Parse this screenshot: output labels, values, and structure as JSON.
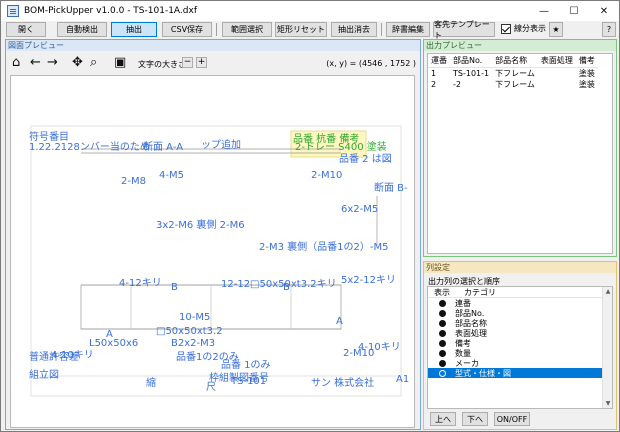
{
  "window": {
    "title": "BOM-PickUpper v1.0.0 - TS-101-1A.dxf",
    "min": "—",
    "max": "☐",
    "close": "✕"
  },
  "toolbar": {
    "open": "開く",
    "auto_detect": "自動検出",
    "extract": "抽出",
    "csv_save": "CSV保存",
    "range_select": "範囲選択",
    "rect_reset": "矩形リセット",
    "extract_clear": "抽出消去",
    "dict_edit": "辞書編集",
    "client_template": "客先テンプレート",
    "show_lines": "線分表示",
    "star": "★",
    "help": "?"
  },
  "drawing_panel": {
    "title": "図面プレビュー",
    "font_size_label": "文字の大きさ",
    "minus": "−",
    "plus": "+",
    "coord": "(x, y) = (4546 , 1752 )",
    "labels": [
      {
        "t": "符号番目",
        "c": "#3a6fd8"
      },
      {
        "t": "1.22.2128ンバー当のため",
        "c": "#3a6fd8"
      },
      {
        "t": "断面 A-A",
        "c": "#3a6fd8"
      },
      {
        "t": "ップ追加",
        "c": "#3a6fd8"
      },
      {
        "t": "品番 杭番 備考",
        "c": "#2fa82f"
      },
      {
        "t": "2-ドレー S400 塗装",
        "c": "#2fa82f"
      },
      {
        "t": "品番 2 は図",
        "c": "#3a6fd8"
      },
      {
        "t": "2-M8",
        "c": "#3a6fd8"
      },
      {
        "t": "4-M5",
        "c": "#3a6fd8"
      },
      {
        "t": "2-M10",
        "c": "#3a6fd8"
      },
      {
        "t": "断面 B-",
        "c": "#3a6fd8"
      },
      {
        "t": "6x2-M5",
        "c": "#3a6fd8"
      },
      {
        "t": "3x2-M6 裏側 2-M6",
        "c": "#3a6fd8"
      },
      {
        "t": "2-M3 裏側（品番1の2）-M5",
        "c": "#3a6fd8"
      },
      {
        "t": "4-12キリ",
        "c": "#3a6fd8"
      },
      {
        "t": "12-12□50x50xt3.2キリ",
        "c": "#3a6fd8"
      },
      {
        "t": "5x2-12キリ",
        "c": "#3a6fd8"
      },
      {
        "t": "B",
        "c": "#3a6fd8"
      },
      {
        "t": "B",
        "c": "#3a6fd8"
      },
      {
        "t": "10-M5",
        "c": "#3a6fd8"
      },
      {
        "t": "□50x50xt3.2",
        "c": "#3a6fd8"
      },
      {
        "t": "A",
        "c": "#3a6fd8"
      },
      {
        "t": "A",
        "c": "#3a6fd8"
      },
      {
        "t": "L50x50x6",
        "c": "#3a6fd8"
      },
      {
        "t": "4-10キリ",
        "c": "#3a6fd8"
      },
      {
        "t": "B2x2-M3",
        "c": "#3a6fd8"
      },
      {
        "t": "品番1の2のみ",
        "c": "#3a6fd8"
      },
      {
        "t": "2-M10",
        "c": "#3a6fd8"
      },
      {
        "t": "普通許容差",
        "c": "#3a6fd8"
      },
      {
        "t": "4-10キリ",
        "c": "#3a6fd8"
      },
      {
        "t": "品番 1のみ",
        "c": "#3a6fd8"
      },
      {
        "t": "組立図",
        "c": "#3a6fd8"
      },
      {
        "t": "枠組製図番号",
        "c": "#3a6fd8"
      },
      {
        "t": "TS-101",
        "c": "#3a6fd8"
      },
      {
        "t": "サン 株式会社",
        "c": "#3a6fd8"
      },
      {
        "t": "A1",
        "c": "#3a6fd8"
      },
      {
        "t": "縮",
        "c": "#3a6fd8"
      },
      {
        "t": "尺",
        "c": "#3a6fd8"
      }
    ]
  },
  "output_panel": {
    "title": "出力プレビュー",
    "headers": [
      "運番",
      "部品No.",
      "部品名称",
      "表面処理",
      "備考"
    ],
    "rows": [
      [
        "1",
        "TS-101-1",
        "下フレーム",
        "",
        "塗装"
      ],
      [
        "2",
        "-2",
        "下フレーム",
        "",
        "塗装"
      ]
    ]
  },
  "column_panel": {
    "title": "列設定",
    "subtitle": "出力列の選択と順序",
    "headers": [
      "表示",
      "カテゴリ"
    ],
    "items": [
      "連番",
      "部品No.",
      "部品名称",
      "表面処理",
      "備考",
      "数量",
      "メーカ",
      "型式・仕様・図"
    ],
    "up": "上へ",
    "down": "下へ",
    "toggle": "ON/OFF"
  }
}
